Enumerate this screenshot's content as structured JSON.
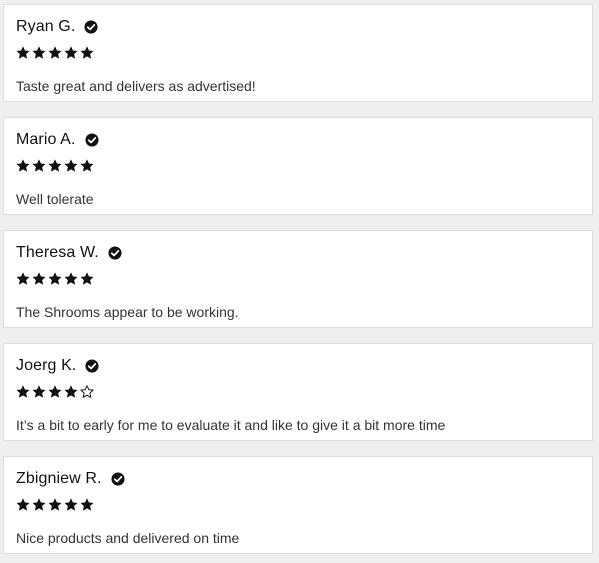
{
  "colors": {
    "page_bg": "#eeeff1",
    "card_bg": "#ffffff",
    "card_border": "#d9dde2",
    "text": "#111111",
    "star": "#111111"
  },
  "reviews": [
    {
      "name": "Ryan G.",
      "verified_icon": "check-circle-icon",
      "rating": 5,
      "max_rating": 5,
      "text": "Taste great and delivers as advertised!"
    },
    {
      "name": "Mario A.",
      "verified_icon": "check-circle-icon",
      "rating": 5,
      "max_rating": 5,
      "text": "Well tolerate"
    },
    {
      "name": "Theresa W.",
      "verified_icon": "check-circle-icon",
      "rating": 5,
      "max_rating": 5,
      "text": "The Shrooms appear to be working."
    },
    {
      "name": "Joerg K.",
      "verified_icon": "check-circle-icon",
      "rating": 4,
      "max_rating": 5,
      "text": "It’s a bit to early for me to evaluate it and like to give it a bit more time"
    },
    {
      "name": "Zbigniew R.",
      "verified_icon": "check-circle-icon",
      "rating": 5,
      "max_rating": 5,
      "text": "Nice products and delivered on time"
    }
  ]
}
